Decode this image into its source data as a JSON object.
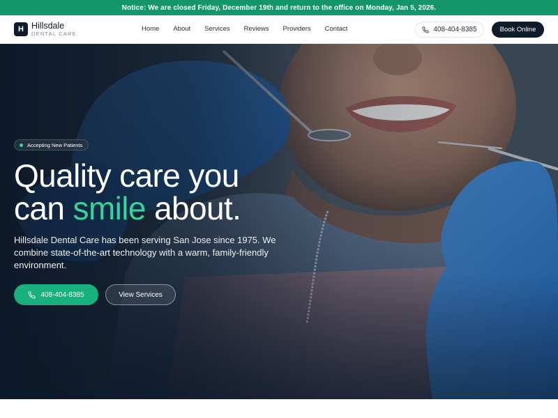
{
  "notice": {
    "text": "Notice: We are closed Friday, December 19th and return to the office on Monday, Jan 5, 2026."
  },
  "header": {
    "logo_letter": "H",
    "logo_name": "Hillsdale",
    "logo_sub": "DENTAL CARE",
    "nav": [
      "Home",
      "About",
      "Services",
      "Reviews",
      "Providers",
      "Contact"
    ],
    "phone": "408-404-8385",
    "book_label": "Book Online"
  },
  "hero": {
    "badge": "Accepting New Patients",
    "headline_line1": "Quality care you",
    "headline_pre": "can ",
    "headline_accent": "smile",
    "headline_post": " about.",
    "subtext": "Hillsdale Dental Care has been serving San Jose since 1975. We combine state-of-the-art technology with a warm, family-friendly environment.",
    "call_label": "408-404-8385",
    "services_label": "View Services"
  },
  "colors": {
    "brand_green": "#15966a",
    "accent_green": "#37d399",
    "button_green": "#18b07c",
    "navy": "#0d1b2a"
  },
  "icons": {
    "phone": "phone-icon",
    "dot": "status-dot-icon"
  }
}
